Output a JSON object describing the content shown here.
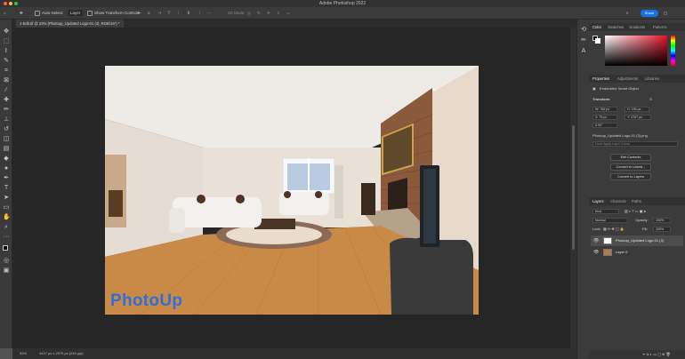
{
  "window": {
    "title": "Adobe Photoshop 2022",
    "share_label": "Share"
  },
  "options_bar": {
    "auto_select_label": "Auto-Select:",
    "auto_select_value": "Layer",
    "show_transform_label": "Show Transform Controls",
    "mode_3d_label": "3D Mode:"
  },
  "document": {
    "tab_label": "1-Edit.tif @ 33% (Photoup_Updated Logo-01 (3), RGB/16*) *",
    "watermark": "PhotoUp"
  },
  "status_bar": {
    "zoom": "33%",
    "doc_info": "4417 px x 2975 px (240 ppi)"
  },
  "panels": {
    "top_tabs": [
      "Color",
      "Swatches",
      "Gradients",
      "Patterns"
    ],
    "props_tabs": [
      "Properties",
      "Adjustments",
      "Libraries"
    ],
    "props": {
      "type_label": "Embedded Smart Object",
      "transform_label": "Transform",
      "w": "W: 769 px",
      "h": "H: 190 px",
      "x": "X: 75 px",
      "y": "Y: 2767 px",
      "angle": "0.00°",
      "filename": "Photoup_Updated Logo-01 (3).png",
      "comps_placeholder": "Don't Apply Layer Comp",
      "buttons": [
        "Edit Contents",
        "Convert to Linked...",
        "Convert to Layers"
      ]
    },
    "layers_tabs": [
      "Layers",
      "Channels",
      "Paths"
    ],
    "layers": {
      "kind_label": "Kind",
      "blend_mode": "Normal",
      "opacity_label": "Opacity:",
      "opacity_value": "100%",
      "lock_label": "Lock:",
      "fill_label": "Fill:",
      "fill_value": "100%",
      "items": [
        {
          "name": "Photoup_Updated Logo-01 (3)"
        },
        {
          "name": "Layer 0"
        }
      ]
    }
  },
  "colors": {
    "accent": "#1473e6",
    "watermark": "#2f6fd6"
  }
}
